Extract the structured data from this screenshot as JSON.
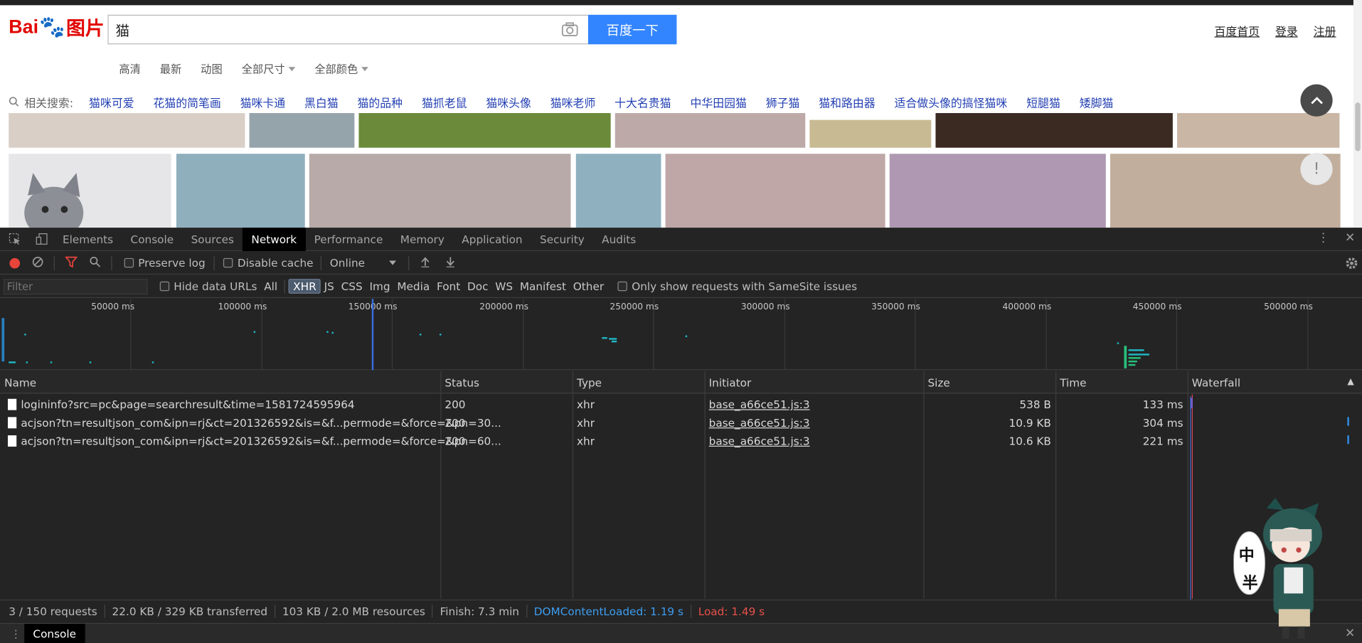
{
  "baidu": {
    "logo_text_latin": "Bai",
    "logo_text_du": "du",
    "logo_text_img": "图片",
    "search_value": "猫",
    "search_button": "百度一下",
    "top_links": [
      "百度首页",
      "登录",
      "注册"
    ],
    "filters": [
      "高清",
      "最新",
      "动图",
      "全部尺寸",
      "全部颜色"
    ],
    "related_label": "相关搜索:",
    "related_links": [
      "猫咪可爱",
      "花猫的简笔画",
      "猫咪卡通",
      "黑白猫",
      "猫的品种",
      "猫抓老鼠",
      "猫咪头像",
      "猫咪老师",
      "十大名贵猫",
      "中华田园猫",
      "狮子猫",
      "猫和路由器",
      "适合做头像的搞怪猫咪",
      "短腿猫",
      "矮脚猫"
    ],
    "info_button": "!"
  },
  "devtools": {
    "tabs": [
      "Elements",
      "Console",
      "Sources",
      "Network",
      "Performance",
      "Memory",
      "Application",
      "Security",
      "Audits"
    ],
    "active_tab": "Network",
    "toolbar": {
      "preserve_log": "Preserve log",
      "disable_cache": "Disable cache",
      "throttle": "Online"
    },
    "filter": {
      "placeholder": "Filter",
      "hide_data_urls": "Hide data URLs",
      "types": [
        "All",
        "XHR",
        "JS",
        "CSS",
        "Img",
        "Media",
        "Font",
        "Doc",
        "WS",
        "Manifest",
        "Other"
      ],
      "selected_type": "XHR",
      "samesite": "Only show requests with SameSite issues"
    },
    "overview_ticks": [
      "50000 ms",
      "100000 ms",
      "150000 ms",
      "200000 ms",
      "250000 ms",
      "300000 ms",
      "350000 ms",
      "400000 ms",
      "450000 ms",
      "500000 ms"
    ],
    "columns": [
      "Name",
      "Status",
      "Type",
      "Initiator",
      "Size",
      "Time",
      "Waterfall"
    ],
    "requests": [
      {
        "name": "logininfo?src=pc&page=searchresult&time=1581724595964",
        "status": "200",
        "type": "xhr",
        "initiator": "base_a66ce51.js:3",
        "size": "538 B",
        "time": "133 ms"
      },
      {
        "name": "acjson?tn=resultjson_com&ipn=rj&ct=201326592&is=&f...permode=&force=&pn=30...",
        "status": "200",
        "type": "xhr",
        "initiator": "base_a66ce51.js:3",
        "size": "10.9 KB",
        "time": "304 ms"
      },
      {
        "name": "acjson?tn=resultjson_com&ipn=rj&ct=201326592&is=&f...permode=&force=&pn=60...",
        "status": "200",
        "type": "xhr",
        "initiator": "base_a66ce51.js:3",
        "size": "10.6 KB",
        "time": "221 ms"
      }
    ],
    "status": {
      "requests": "3 / 150 requests",
      "transferred": "22.0 KB / 329 KB transferred",
      "resources": "103 KB / 2.0 MB resources",
      "finish": "Finish: 7.3 min",
      "dcl": "DOMContentLoaded: 1.19 s",
      "load": "Load: 1.49 s"
    },
    "drawer_tab": "Console",
    "colors": {
      "dcl": "#3d9df0",
      "load": "#e8504a",
      "accent": "#1fb6c4"
    }
  },
  "mascot": {
    "text1": "中",
    "text2": "半"
  }
}
